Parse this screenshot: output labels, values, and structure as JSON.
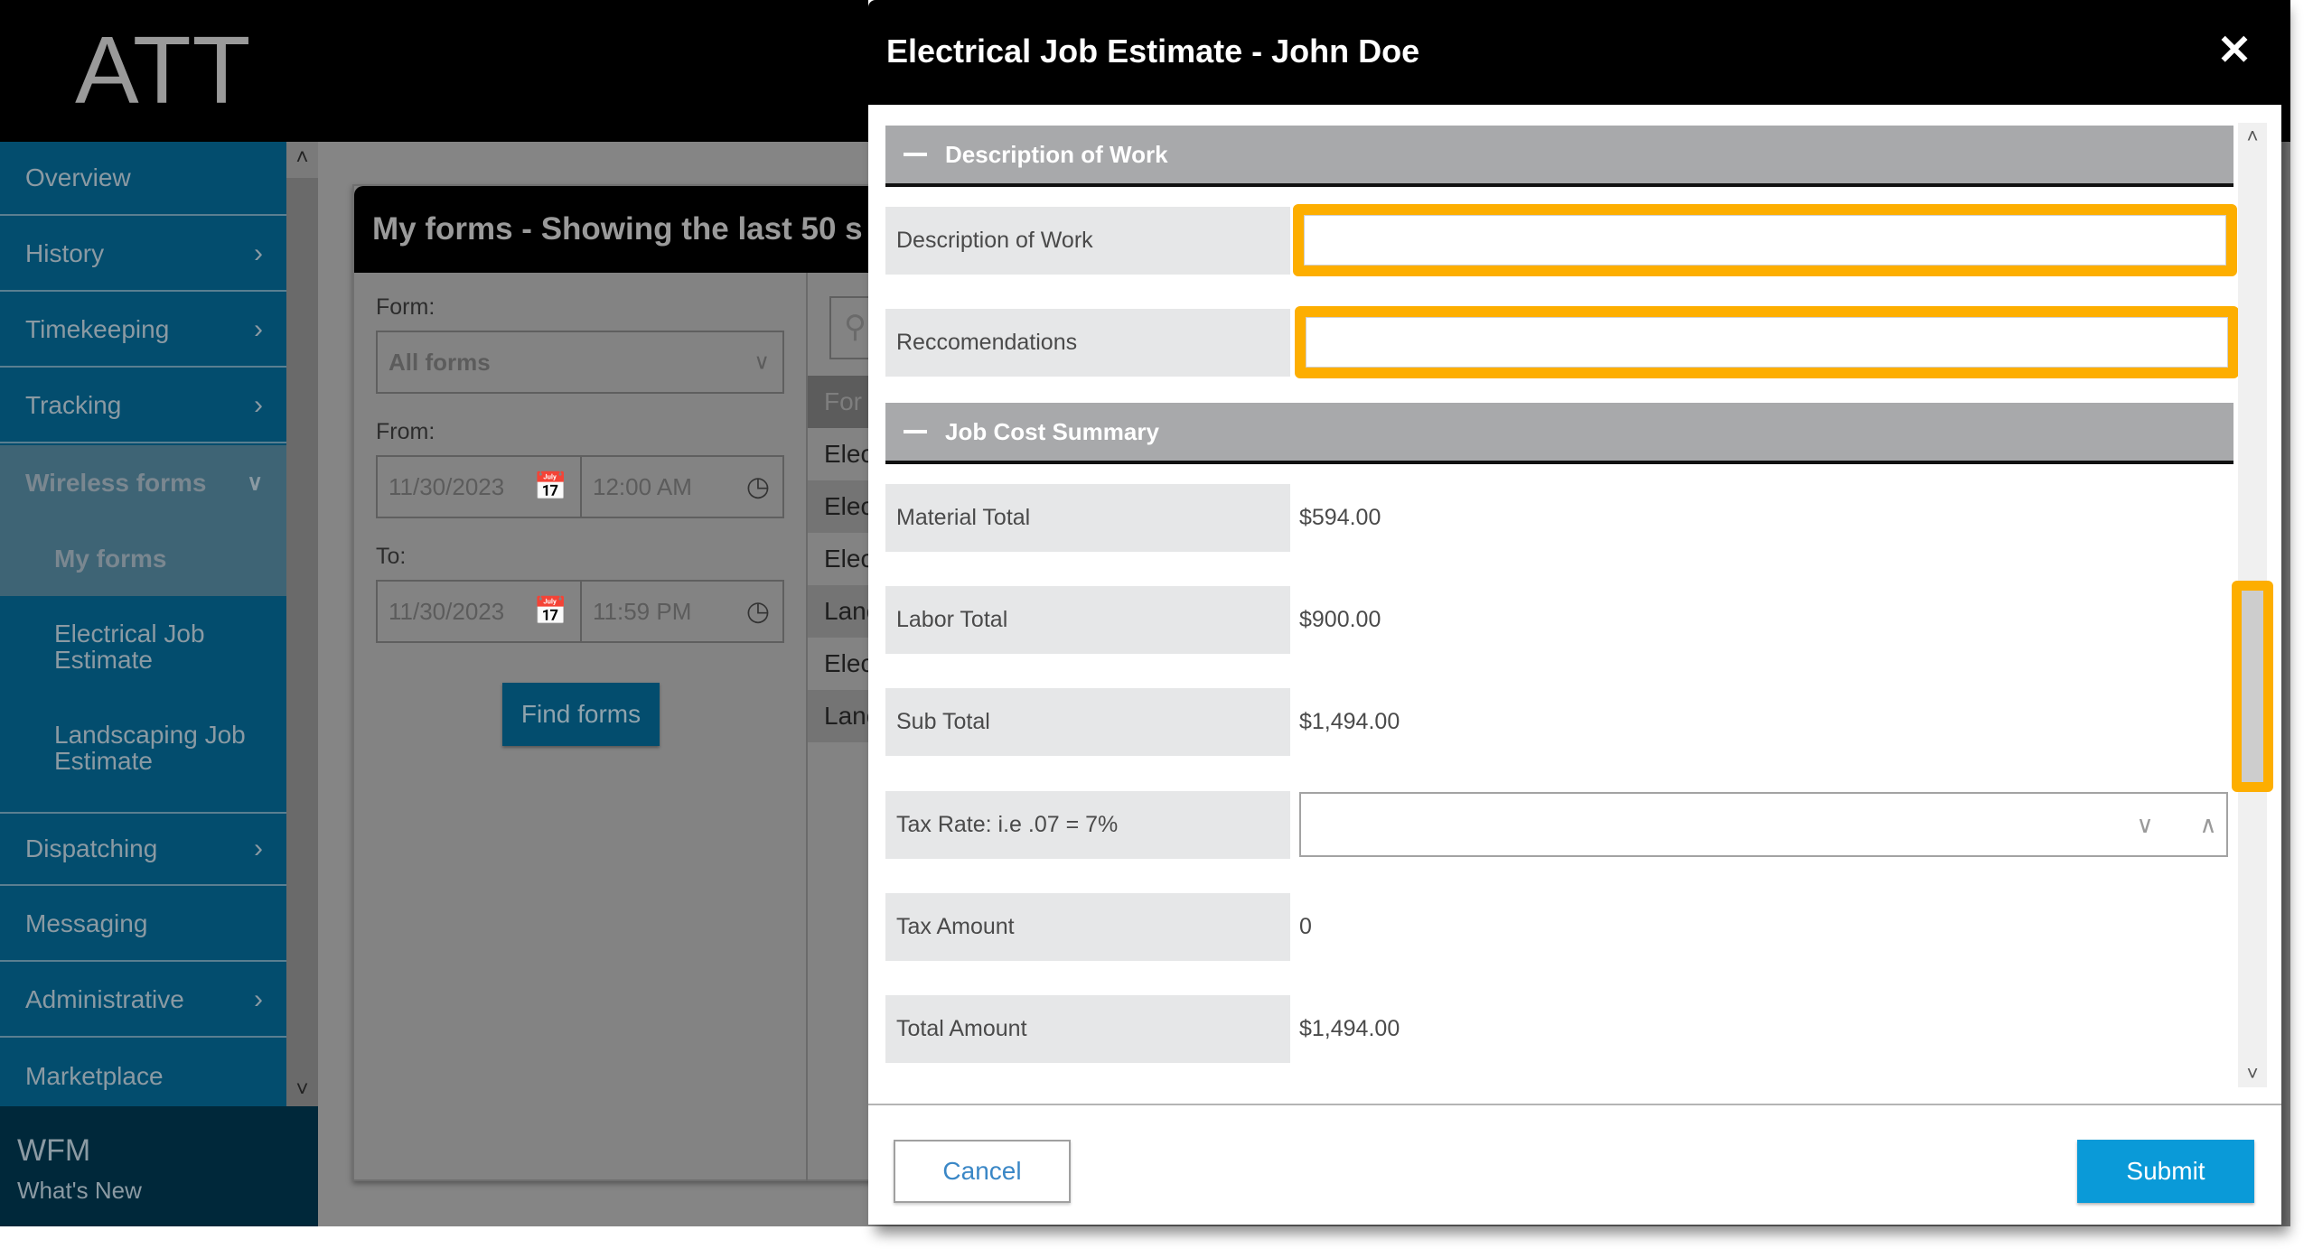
{
  "app": {
    "logo_text": "ATT",
    "footer_title": "WFM",
    "footer_link": "What's New"
  },
  "sidebar": {
    "items": [
      {
        "label": "Overview",
        "has_children": false
      },
      {
        "label": "History",
        "has_children": true
      },
      {
        "label": "Timekeeping",
        "has_children": true
      },
      {
        "label": "Tracking",
        "has_children": true
      },
      {
        "label": "Wireless forms",
        "has_children": true,
        "expanded": true
      },
      {
        "label": "Dispatching",
        "has_children": true
      },
      {
        "label": "Messaging",
        "has_children": false
      },
      {
        "label": "Administrative",
        "has_children": true
      },
      {
        "label": "Marketplace",
        "has_children": false
      }
    ],
    "wireless_forms_children": [
      {
        "label": "My forms",
        "active": true
      },
      {
        "label": "Electrical Job Estimate",
        "active": false
      },
      {
        "label": "Landscaping Job Estimate",
        "active": false
      }
    ]
  },
  "forms_panel": {
    "title": "My forms - Showing the last 50 s",
    "form_label": "Form:",
    "form_select_value": "All forms",
    "from_label": "From:",
    "from_date": "11/30/2023",
    "from_time": "12:00 AM",
    "to_label": "To:",
    "to_date": "11/30/2023",
    "to_time": "11:59 PM",
    "find_button": "Find forms",
    "list_header": "For",
    "list_rows": [
      "Elec",
      "Elec",
      "Elec",
      "Lanc",
      "Elec",
      "Lanc"
    ]
  },
  "modal": {
    "title": "Electrical Job Estimate - John Doe",
    "sections": [
      {
        "title": "Description of Work",
        "fields": [
          {
            "label": "Description of Work",
            "value": "",
            "type": "text-input",
            "highlighted": true
          },
          {
            "label": "Reccomendations",
            "value": "",
            "type": "text-input",
            "highlighted": true
          }
        ]
      },
      {
        "title": "Job Cost Summary",
        "fields": [
          {
            "label": "Material Total",
            "value": "$594.00",
            "type": "readonly"
          },
          {
            "label": "Labor Total",
            "value": "$900.00",
            "type": "readonly"
          },
          {
            "label": "Sub Total",
            "value": "$1,494.00",
            "type": "readonly"
          },
          {
            "label": "Tax Rate: i.e .07 = 7%",
            "value": "",
            "type": "number-input"
          },
          {
            "label": "Tax Amount",
            "value": "0",
            "type": "readonly"
          },
          {
            "label": "Total Amount",
            "value": "$1,494.00",
            "type": "readonly"
          }
        ]
      }
    ],
    "cancel_button": "Cancel",
    "submit_button": "Submit",
    "scroll_position": 0.62
  },
  "colors": {
    "highlight": "#fdae00",
    "sidebar_bg": "#034d6e",
    "submit_bg": "#0a9ad8",
    "section_header_bg": "#a8a9ab"
  }
}
